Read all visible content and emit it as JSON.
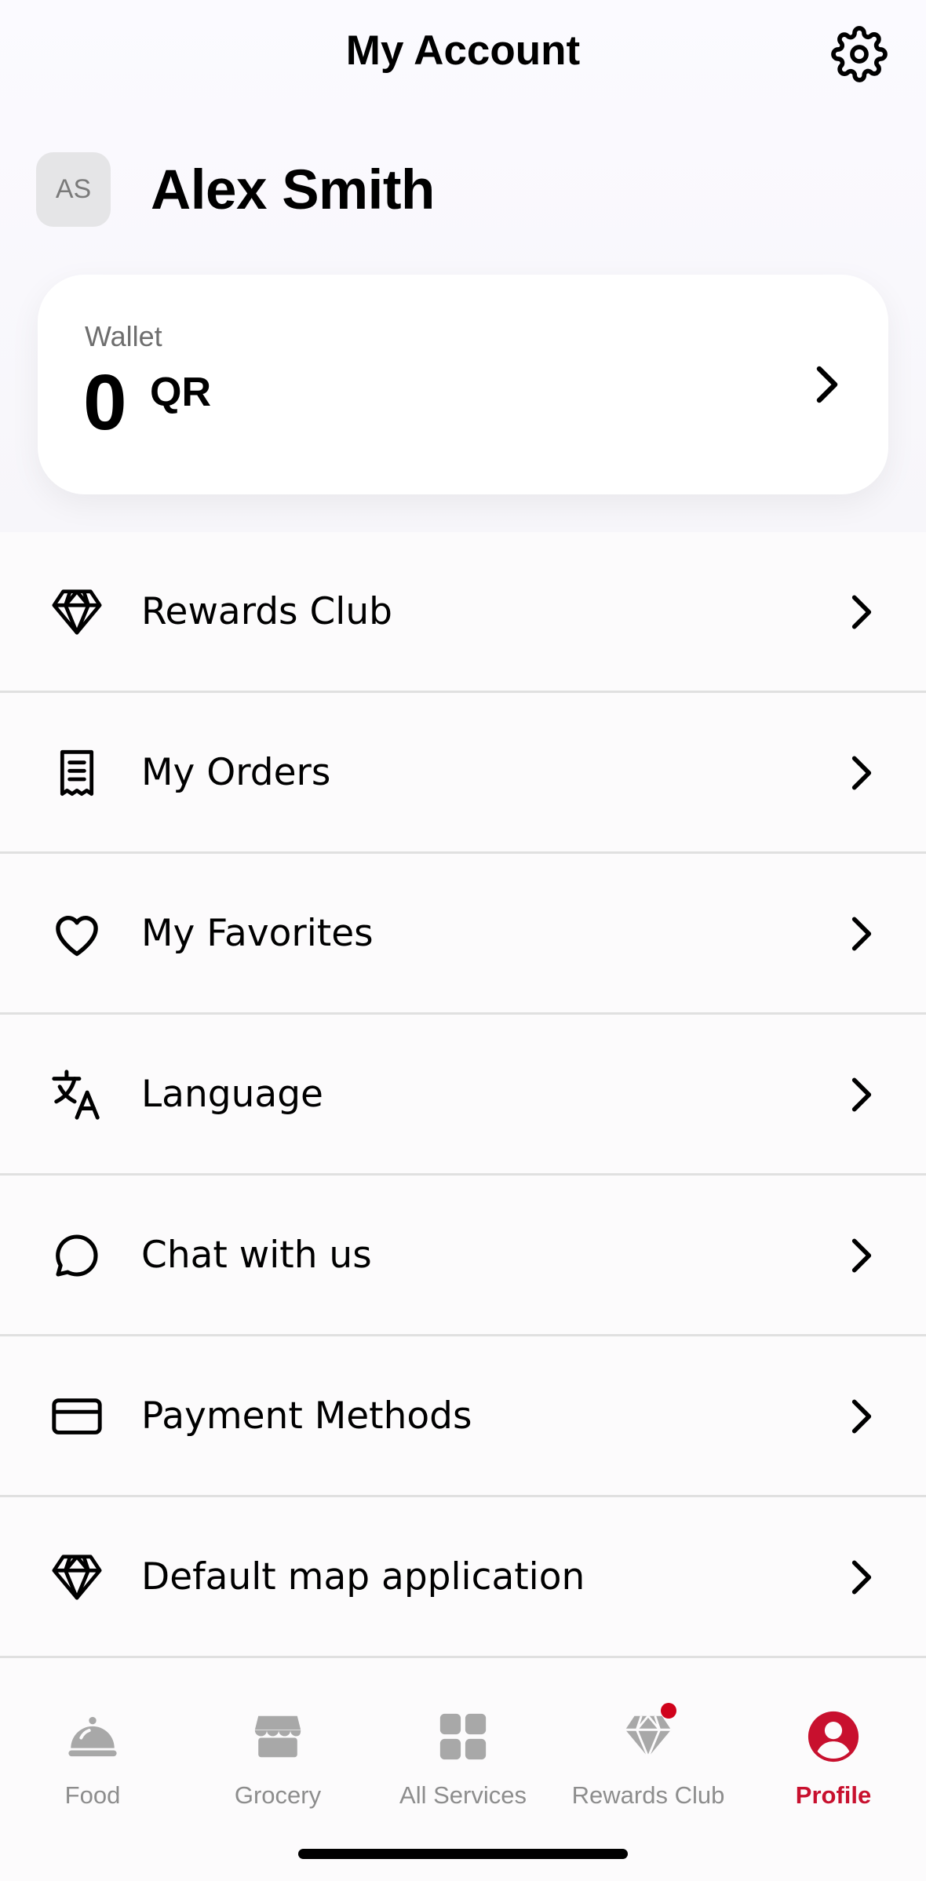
{
  "header": {
    "title": "My Account"
  },
  "user": {
    "initials": "AS",
    "name": "Alex Smith"
  },
  "wallet": {
    "label": "Wallet",
    "amount": "0",
    "currency": "QR"
  },
  "menu": [
    {
      "label": "Rewards Club",
      "icon": "diamond-icon"
    },
    {
      "label": "My Orders",
      "icon": "receipt-icon"
    },
    {
      "label": "My Favorites",
      "icon": "heart-icon"
    },
    {
      "label": "Language",
      "icon": "translate-icon"
    },
    {
      "label": "Chat with us",
      "icon": "chat-bubble-icon"
    },
    {
      "label": "Payment Methods",
      "icon": "credit-card-icon"
    },
    {
      "label": "Default map application",
      "icon": "diamond-icon"
    }
  ],
  "tabbar": [
    {
      "label": "Food",
      "icon": "cloche-icon"
    },
    {
      "label": "Grocery",
      "icon": "store-icon"
    },
    {
      "label": "All Services",
      "icon": "grid-icon"
    },
    {
      "label": "Rewards Club",
      "icon": "diamond-icon",
      "badge": true
    },
    {
      "label": "Profile",
      "icon": "profile-icon",
      "active": true
    }
  ],
  "colors": {
    "accent": "#c8102e",
    "inactive": "#8d8d8d"
  }
}
